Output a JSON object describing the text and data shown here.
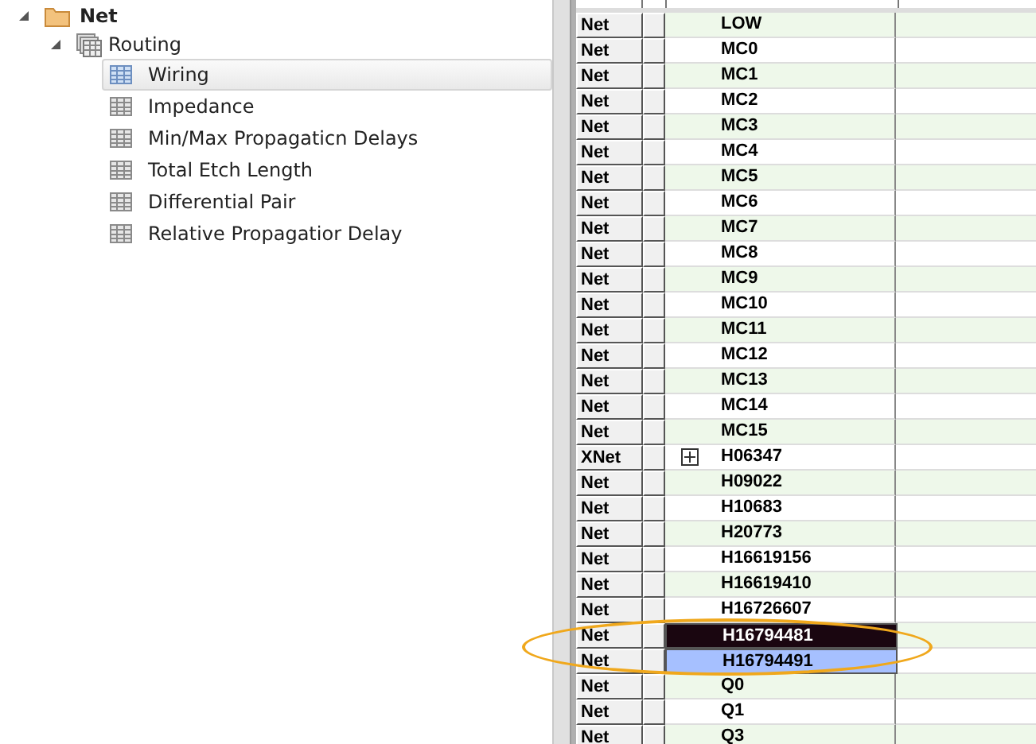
{
  "tree": {
    "label": "Net",
    "expanded": true,
    "children": [
      {
        "label": "Routing",
        "expanded": true,
        "children": [
          {
            "label": "Wiring",
            "selected": true
          },
          {
            "label": "Impedance",
            "selected": false
          },
          {
            "label": "Min/Max Propagaticn Delays",
            "selected": false
          },
          {
            "label": "Total Etch Length",
            "selected": false
          },
          {
            "label": "Differential Pair",
            "selected": false
          },
          {
            "label": "Relative Propagatior Delay",
            "selected": false
          }
        ]
      }
    ]
  },
  "grid": {
    "rows": [
      {
        "type": "Net",
        "name": "LOW",
        "selected": false,
        "focused": false
      },
      {
        "type": "Net",
        "name": "MC0",
        "selected": false,
        "focused": false
      },
      {
        "type": "Net",
        "name": "MC1",
        "selected": false,
        "focused": false
      },
      {
        "type": "Net",
        "name": "MC2",
        "selected": false,
        "focused": false
      },
      {
        "type": "Net",
        "name": "MC3",
        "selected": false,
        "focused": false
      },
      {
        "type": "Net",
        "name": "MC4",
        "selected": false,
        "focused": false
      },
      {
        "type": "Net",
        "name": "MC5",
        "selected": false,
        "focused": false
      },
      {
        "type": "Net",
        "name": "MC6",
        "selected": false,
        "focused": false
      },
      {
        "type": "Net",
        "name": "MC7",
        "selected": false,
        "focused": false
      },
      {
        "type": "Net",
        "name": "MC8",
        "selected": false,
        "focused": false
      },
      {
        "type": "Net",
        "name": "MC9",
        "selected": false,
        "focused": false
      },
      {
        "type": "Net",
        "name": "MC10",
        "selected": false,
        "focused": false
      },
      {
        "type": "Net",
        "name": "MC11",
        "selected": false,
        "focused": false
      },
      {
        "type": "Net",
        "name": "MC12",
        "selected": false,
        "focused": false
      },
      {
        "type": "Net",
        "name": "MC13",
        "selected": false,
        "focused": false
      },
      {
        "type": "Net",
        "name": "MC14",
        "selected": false,
        "focused": false
      },
      {
        "type": "Net",
        "name": "MC15",
        "selected": false,
        "focused": false
      },
      {
        "type": "XNet",
        "name": "H06347",
        "selected": false,
        "focused": false,
        "expandable": true
      },
      {
        "type": "Net",
        "name": "H09022",
        "selected": false,
        "focused": false
      },
      {
        "type": "Net",
        "name": "H10683",
        "selected": false,
        "focused": false
      },
      {
        "type": "Net",
        "name": "H20773",
        "selected": false,
        "focused": false
      },
      {
        "type": "Net",
        "name": "H16619156",
        "selected": false,
        "focused": false
      },
      {
        "type": "Net",
        "name": "H16619410",
        "selected": false,
        "focused": false
      },
      {
        "type": "Net",
        "name": "H16726607",
        "selected": false,
        "focused": false
      },
      {
        "type": "Net",
        "name": "H16794481",
        "selected": true,
        "focused": true
      },
      {
        "type": "Net",
        "name": "H16794491",
        "selected": true,
        "focused": false
      },
      {
        "type": "Net",
        "name": "Q0",
        "selected": false,
        "focused": false
      },
      {
        "type": "Net",
        "name": "Q1",
        "selected": false,
        "focused": false
      },
      {
        "type": "Net",
        "name": "Q3",
        "selected": false,
        "focused": false
      }
    ]
  }
}
